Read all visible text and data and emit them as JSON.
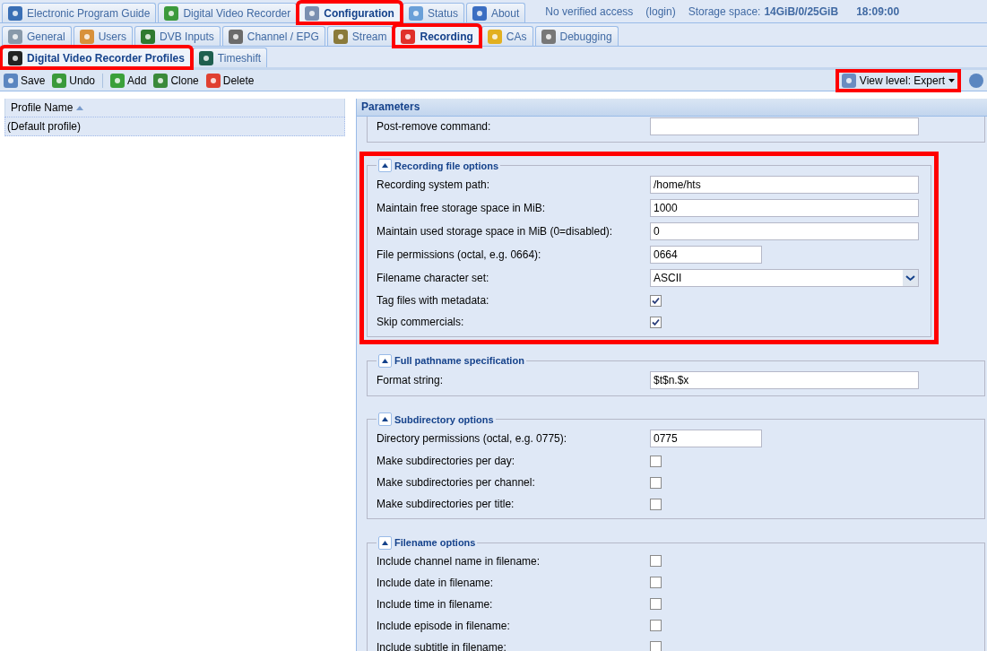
{
  "top_tabs": [
    {
      "label": "Electronic Program Guide",
      "selected": false,
      "highlighted": false
    },
    {
      "label": "Digital Video Recorder",
      "selected": false,
      "highlighted": false
    },
    {
      "label": "Configuration",
      "selected": true,
      "highlighted": true
    },
    {
      "label": "Status",
      "selected": false,
      "highlighted": false
    },
    {
      "label": "About",
      "selected": false,
      "highlighted": false
    }
  ],
  "header_status": {
    "access": "No verified access",
    "login": "(login)",
    "storage_label": "Storage space:",
    "storage_value": "14GiB/0/25GiB",
    "time": "18:09:00"
  },
  "config_tabs": [
    {
      "label": "General",
      "selected": false,
      "highlighted": false
    },
    {
      "label": "Users",
      "selected": false,
      "highlighted": false
    },
    {
      "label": "DVB Inputs",
      "selected": false,
      "highlighted": false
    },
    {
      "label": "Channel / EPG",
      "selected": false,
      "highlighted": false
    },
    {
      "label": "Stream",
      "selected": false,
      "highlighted": false
    },
    {
      "label": "Recording",
      "selected": true,
      "highlighted": true
    },
    {
      "label": "CAs",
      "selected": false,
      "highlighted": false
    },
    {
      "label": "Debugging",
      "selected": false,
      "highlighted": false
    }
  ],
  "recording_tabs": [
    {
      "label": "Digital Video Recorder Profiles",
      "selected": true,
      "highlighted": true
    },
    {
      "label": "Timeshift",
      "selected": false,
      "highlighted": false
    }
  ],
  "toolbar": {
    "buttons": [
      "Save",
      "Undo",
      "Add",
      "Clone",
      "Delete"
    ],
    "view_level": {
      "label": "View level: Expert",
      "highlighted": true
    }
  },
  "grid": {
    "columns": [
      "Profile Name"
    ],
    "rows": [
      {
        "cells": [
          "(Default profile)"
        ],
        "selected": true
      }
    ]
  },
  "parameters": {
    "title": "Parameters",
    "groups": [
      {
        "highlighted": false,
        "fields": [
          {
            "kind": "text",
            "label": "Post-remove command:"
          }
        ]
      },
      {
        "legend": "Recording file options",
        "expanded": true,
        "highlighted": true,
        "fields": [
          {
            "kind": "text",
            "label": "Recording system path:",
            "value": "/home/hts"
          },
          {
            "kind": "text",
            "label": "Maintain free storage space in MiB:",
            "value": "1000"
          },
          {
            "kind": "text",
            "label": "Maintain used storage space in MiB (0=disabled):",
            "value": "0"
          },
          {
            "kind": "short_text",
            "label": "File permissions (octal, e.g. 0664):",
            "value": "0664"
          },
          {
            "kind": "select",
            "label": "Filename character set:",
            "value": "ASCII"
          },
          {
            "kind": "checkbox",
            "label": "Tag files with metadata:",
            "checked": true
          },
          {
            "kind": "checkbox",
            "label": "Skip commercials:",
            "checked": true
          }
        ]
      },
      {
        "legend": "Full pathname specification",
        "expanded": true,
        "highlighted": false,
        "fields": [
          {
            "kind": "text",
            "label": "Format string:",
            "value": "$t$n.$x"
          }
        ]
      },
      {
        "legend": "Subdirectory options",
        "expanded": true,
        "highlighted": false,
        "fields": [
          {
            "kind": "short_text",
            "label": "Directory permissions (octal, e.g. 0775):",
            "value": "0775"
          },
          {
            "kind": "checkbox",
            "label": "Make subdirectories per day:",
            "checked": false
          },
          {
            "kind": "checkbox",
            "label": "Make subdirectories per channel:",
            "checked": false
          },
          {
            "kind": "checkbox",
            "label": "Make subdirectories per title:",
            "checked": false
          }
        ]
      },
      {
        "legend": "Filename options",
        "expanded": true,
        "highlighted": false,
        "fields": [
          {
            "kind": "checkbox",
            "label": "Include channel name in filename:",
            "checked": false
          },
          {
            "kind": "checkbox",
            "label": "Include date in filename:",
            "checked": false
          },
          {
            "kind": "checkbox",
            "label": "Include time in filename:",
            "checked": false
          },
          {
            "kind": "checkbox",
            "label": "Include episode in filename:",
            "checked": false
          },
          {
            "kind": "checkbox",
            "label": "Include subtitle in filename:",
            "checked": false
          }
        ]
      }
    ]
  }
}
